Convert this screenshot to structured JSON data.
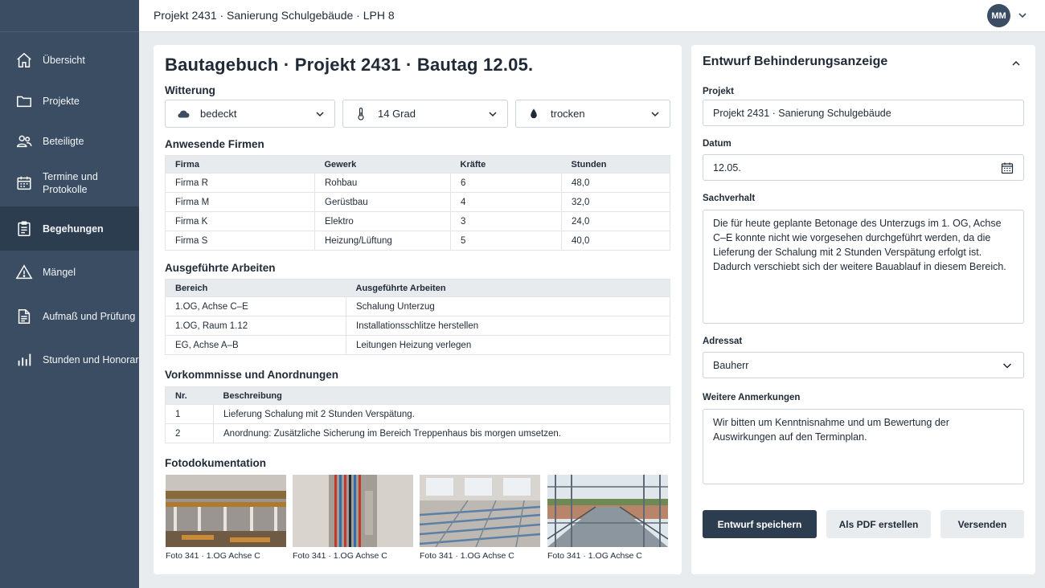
{
  "sidebar": {
    "items": [
      {
        "label": "Übersicht",
        "icon": "home-icon"
      },
      {
        "label": "Projekte",
        "icon": "folder-icon"
      },
      {
        "label": "Beteiligte",
        "icon": "users-icon"
      },
      {
        "label": "Termine und Protokolle",
        "label_line1": "Termine und",
        "label_line2": "Protokolle",
        "icon": "calendar-icon"
      },
      {
        "label": "Begehungen",
        "icon": "clipboard-icon",
        "active": true
      },
      {
        "label": "Mängel",
        "icon": "warning-icon"
      },
      {
        "label": "Aufmaß und Prüfung",
        "icon": "document-icon"
      },
      {
        "label": "Stunden und Honorar",
        "icon": "bar-chart-icon"
      }
    ]
  },
  "topbar": {
    "breadcrumb": "Projekt 2431 · Sanierung Schulgebäude · LPH 8",
    "avatar_initials": "MM"
  },
  "main": {
    "title": "Bautagebuch · Projekt 2431 · Bautag 12.05.",
    "weather": {
      "heading": "Witterung",
      "sky": "bedeckt",
      "temperature": "14 Grad",
      "humidity": "trocken"
    },
    "companies": {
      "heading": "Anwesende Firmen",
      "columns": [
        "Firma",
        "Gewerk",
        "Kräfte",
        "Stunden"
      ],
      "rows": [
        [
          "Firma R",
          "Rohbau",
          "6",
          "48,0"
        ],
        [
          "Firma M",
          "Gerüstbau",
          "4",
          "32,0"
        ],
        [
          "Firma K",
          "Elektro",
          "3",
          "24,0"
        ],
        [
          "Firma S",
          "Heizung/Lüftung",
          "5",
          "40,0"
        ]
      ]
    },
    "works": {
      "heading": "Ausgeführte Arbeiten",
      "columns": [
        "Bereich",
        "Ausgeführte Arbeiten"
      ],
      "rows": [
        [
          "1.OG, Achse C–E",
          "Schalung Unterzug"
        ],
        [
          "1.OG, Raum 1.12",
          "Installationsschlitze herstellen"
        ],
        [
          "EG, Achse A–B",
          "Leitungen Heizung verlegen"
        ]
      ]
    },
    "events": {
      "heading": "Vorkommnisse und Anordnungen",
      "columns": [
        "Nr.",
        "Beschreibung"
      ],
      "rows": [
        [
          "1",
          "Lieferung Schalung mit 2 Stunden Verspätung."
        ],
        [
          "2",
          "Anordnung: Zusätzliche Sicherung im Bereich Treppenhaus bis morgen umsetzen."
        ]
      ]
    },
    "photos": {
      "heading": "Fotodokumentation",
      "captions": [
        "Foto 341 · 1.OG Achse C",
        "Foto 341 · 1.OG Achse C",
        "Foto 341 · 1.OG Achse C",
        "Foto 341 · 1.OG Achse C"
      ]
    }
  },
  "form": {
    "title": "Entwurf Behinderungsanzeige",
    "project_label": "Projekt",
    "project_value": "Projekt 2431 · Sanierung Schulgebäude",
    "date_label": "Datum",
    "date_value": "12.05.",
    "facts_label": "Sachverhalt",
    "facts_value": "Die für heute geplante Betonage des Unterzugs im 1. OG, Achse C–E konnte nicht wie vorgesehen durchgeführt werden, da die Lieferung der Schalung mit 2 Stunden Verspätung erfolgt ist. Dadurch verschiebt sich der weitere Bauablauf in diesem Bereich.",
    "recipient_label": "Adressat",
    "recipient_value": "Bauherr",
    "notes_label": "Weitere Anmerkungen",
    "notes_value": "Wir bitten um Kenntnisnahme und um Bewertung der Auswirkungen auf den Terminplan.",
    "save_label": "Entwurf speichern",
    "pdf_label": "Als PDF erstellen",
    "send_label": "Versenden"
  },
  "colors": {
    "sidebar": "#3b4d62",
    "sidebar_active": "#2c3d50",
    "primary_button": "#2c3d50"
  }
}
